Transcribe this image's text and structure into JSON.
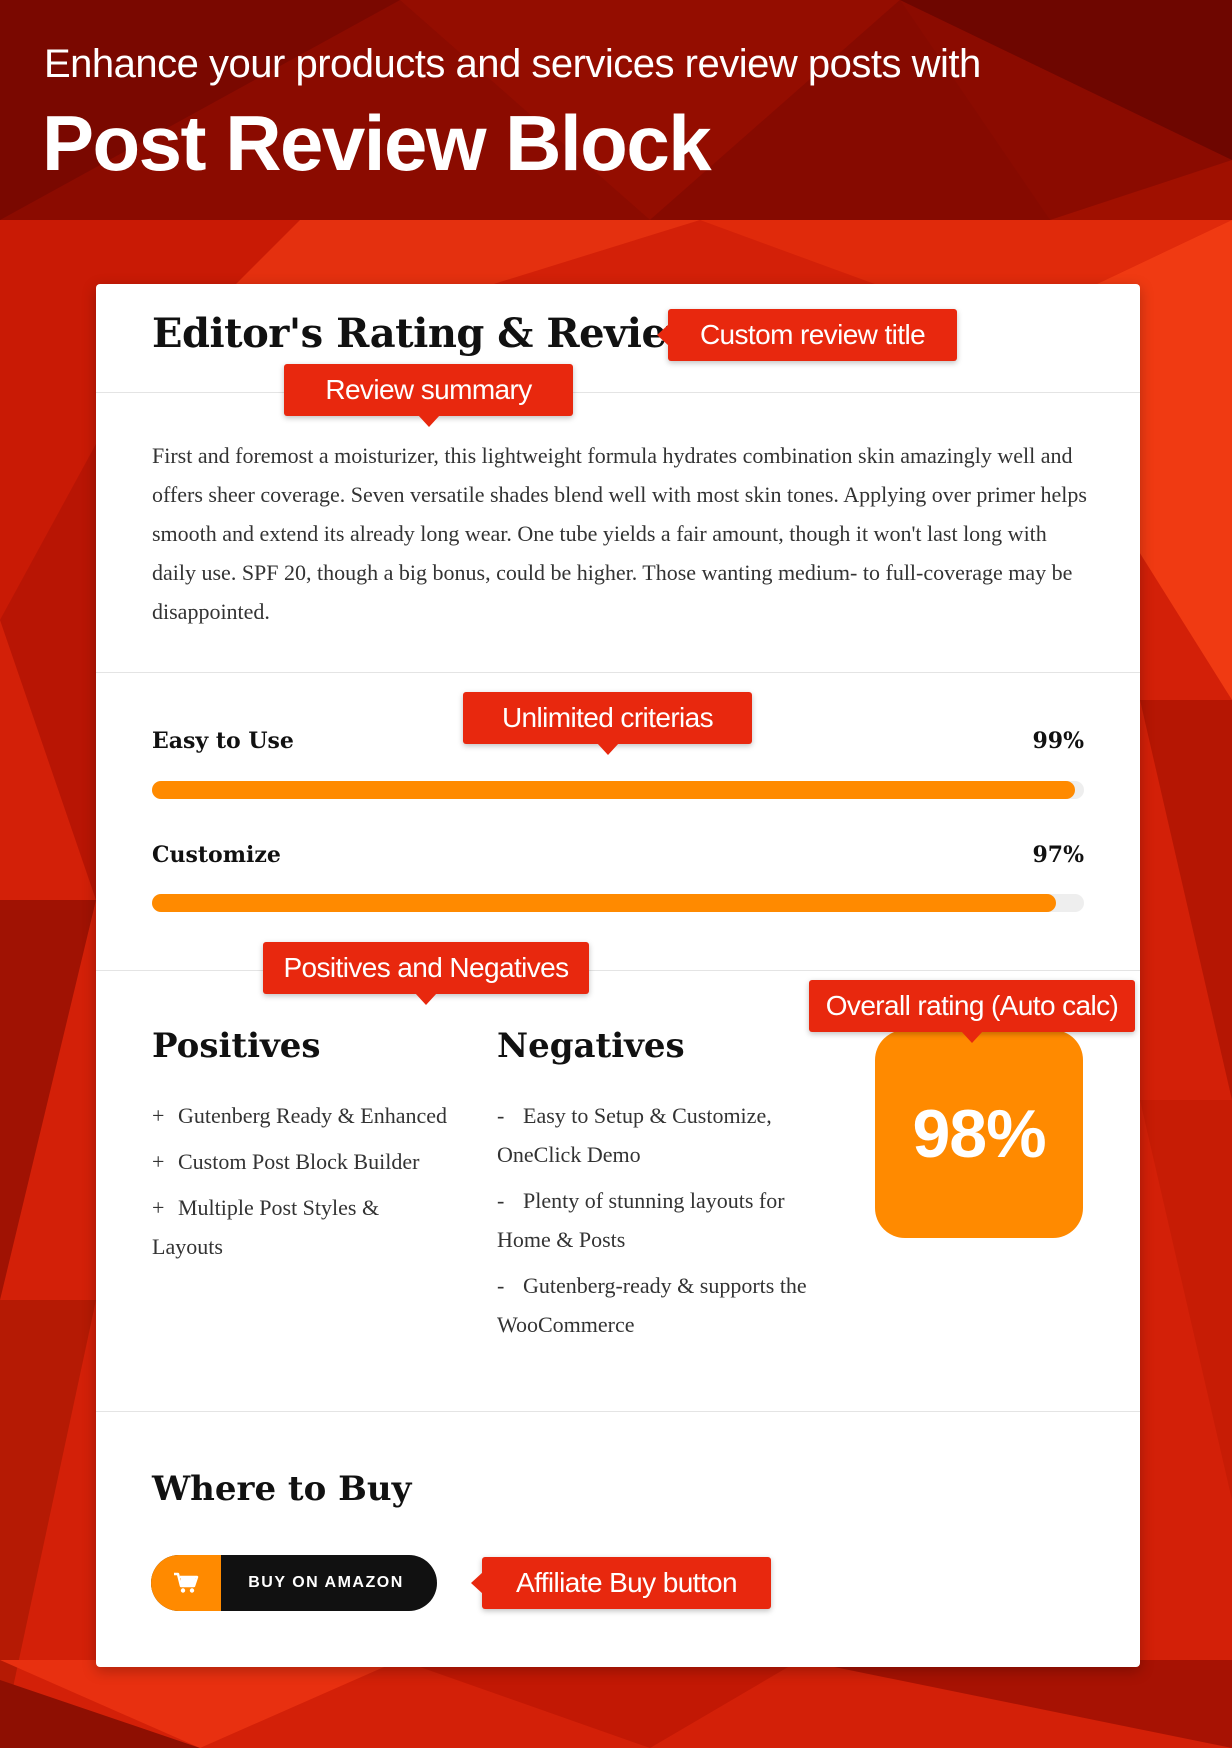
{
  "hero": {
    "subtitle": "Enhance your products and services review posts with",
    "title": "Post Review Block"
  },
  "review": {
    "title": "Editor's Rating & Review",
    "summary": "First and foremost a moisturizer, this lightweight formula hydrates combination skin amazingly well and offers sheer coverage. Seven versatile shades blend well with most skin tones. Applying over primer helps smooth and extend its already long wear. One tube yields a fair amount, though it won't last long with daily use. SPF 20, though a big bonus, could be higher. Those wanting medium- to full-coverage may be disappointed."
  },
  "criteria": [
    {
      "label": "Easy to Use",
      "value_text": "99%",
      "value": 99
    },
    {
      "label": "Customize",
      "value_text": "97%",
      "value": 97
    }
  ],
  "positives": {
    "heading": "Positives",
    "marker": "+",
    "items": [
      "Gutenberg Ready & Enhanced",
      "Custom Post Block Builder",
      "Multiple Post Styles & Layouts"
    ]
  },
  "negatives": {
    "heading": "Negatives",
    "marker": "-",
    "items": [
      "Easy to Setup & Customize, OneClick Demo",
      "Plenty of stunning layouts for Home & Posts",
      "Gutenberg-ready & supports the WooCommerce"
    ]
  },
  "overall": {
    "value_text": "98%"
  },
  "buy": {
    "heading": "Where to Buy",
    "button_label": "BUY ON AMAZON",
    "icon": "cart-icon"
  },
  "callouts": {
    "review_title": "Custom review title",
    "summary": "Review summary",
    "criteria": "Unlimited criterias",
    "pros_cons": "Positives and Negatives",
    "overall": "Overall rating (Auto calc)",
    "buy": "Affiliate Buy button"
  },
  "colors": {
    "accent": "#ff8a00",
    "tag": "#e8280e",
    "header": "#8b0b00",
    "background": "#d8220a"
  }
}
